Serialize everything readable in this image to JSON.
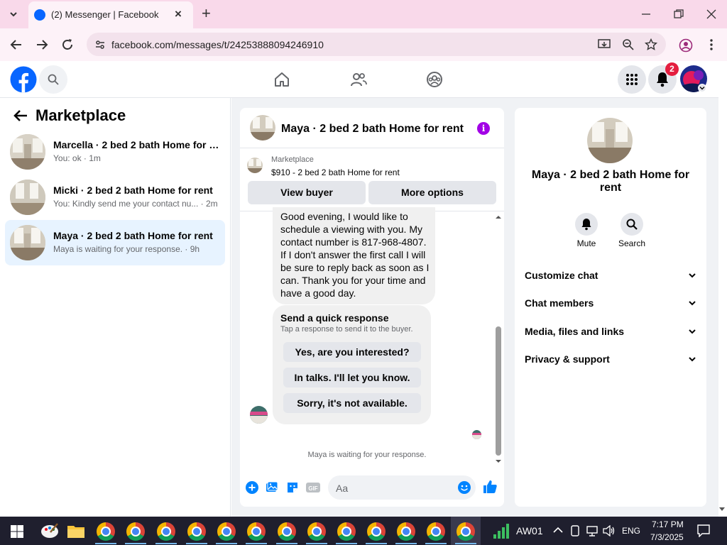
{
  "browser": {
    "tab_title": "(2) Messenger | Facebook",
    "url": "facebook.com/messages/t/24253888094246910"
  },
  "header": {
    "notification_count": "2",
    "brand_color": "#0866ff",
    "badge_color": "#e41e3f"
  },
  "marketplace": {
    "title": "Marketplace",
    "conversations": [
      {
        "name": "Marcella · 2 bed 2 bath Home for r...",
        "preview": "You: ok · 1m"
      },
      {
        "name": "Micki · 2 bed 2 bath Home for rent",
        "preview": "You: Kindly send me your contact nu... · 2m"
      },
      {
        "name": "Maya · 2 bed 2 bath Home for rent",
        "preview": "Maya is waiting for your response. · 9h"
      }
    ]
  },
  "chat": {
    "title": "Maya · 2 bed 2 bath Home for rent",
    "listing_label": "Marketplace",
    "listing_price": "$910 - 2 bed 2 bath Home for rent",
    "view_buyer": "View buyer",
    "more_options": "More options",
    "message": "Good evening, I would like to schedule a viewing with you. My contact number is 817-968-4807. If I don't answer the first call I will be sure to reply back as soon as I can. Thank you for your time and have a good day.",
    "quick_title": "Send a quick response",
    "quick_sub": "Tap a response to send it to the buyer.",
    "quick_responses": [
      "Yes, are you interested?",
      "In talks. I'll let you know.",
      "Sorry, it's not available."
    ],
    "waiting": "Maya is waiting for your response.",
    "input_placeholder": "Aa",
    "accent_color": "#0084ff"
  },
  "info": {
    "name": "Maya · 2 bed 2 bath Home for rent",
    "mute": "Mute",
    "search": "Search",
    "sections": [
      "Customize chat",
      "Chat members",
      "Media, files and links",
      "Privacy & support"
    ]
  },
  "taskbar": {
    "network": "AW01",
    "lang": "ENG",
    "time": "7:17 PM",
    "date": "7/3/2025"
  }
}
